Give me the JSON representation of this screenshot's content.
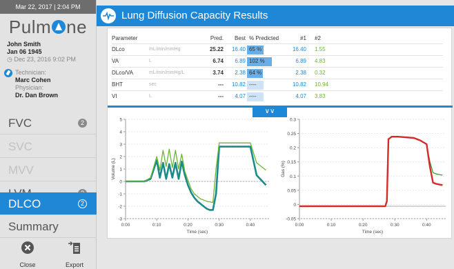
{
  "sidebar": {
    "datetime": "Mar 22, 2017 | 2:04 PM",
    "logo_left": "Pulm",
    "logo_right": "ne",
    "patient_name": "John  Smith",
    "patient_dob": "Jan 06 1945",
    "session_datetime": "Dec 23, 2016 9:02 PM",
    "technician_label": "Technician:",
    "technician_name": "Marc Cohen",
    "physician_label": "Physician:",
    "physician_name": "Dr. Dan Brown",
    "menu": [
      {
        "label": "FVC",
        "badge": "2"
      },
      {
        "label": "SVC",
        "badge": ""
      },
      {
        "label": "MVV",
        "badge": ""
      },
      {
        "label": "LVM",
        "badge": "2"
      },
      {
        "label": "DLCO",
        "badge": "2"
      },
      {
        "label": "Summary",
        "badge": ""
      }
    ],
    "close_label": "Close",
    "export_label": "Export"
  },
  "header": {
    "title": "Lung Diffusion Capacity Results"
  },
  "table": {
    "headers": [
      "Parameter",
      "",
      "Pred.",
      "Best",
      "% Predicted",
      "#1",
      "#2"
    ],
    "rows": [
      {
        "param": "DLco",
        "unit": "mL/min/mmHg",
        "pred": "25.22",
        "best": "16.40",
        "pct": "65 %",
        "t1": "16.40",
        "t2": "1.55"
      },
      {
        "param": "VA",
        "unit": "L",
        "pred": "6.74",
        "best": "6.89",
        "pct": "102 %",
        "t1": "6.89",
        "t2": "4.83"
      },
      {
        "param": "DLco/VA",
        "unit": "mL/min/mmHg/L",
        "pred": "3.74",
        "best": "2.38",
        "pct": "64 %",
        "t1": "2.38",
        "t2": "0.32"
      },
      {
        "param": "BHT",
        "unit": "sec",
        "pred": "---",
        "best": "10.82",
        "pct": "----",
        "t1": "10.82",
        "t2": "10.94"
      },
      {
        "param": "VI",
        "unit": "L",
        "pred": "---",
        "best": "4.07",
        "pct": "----",
        "t1": "4.07",
        "t2": "3.83"
      }
    ]
  },
  "colors": {
    "accent": "#1e88d6",
    "trial1": "#1a8a8a",
    "trial2": "#6ab534",
    "gas_red": "#d42a2a",
    "gas_green": "#3a9a3a"
  },
  "chart_data": [
    {
      "type": "line",
      "title": "",
      "xlabel": "Time (sec)",
      "ylabel": "Volume (L)",
      "xlim": [
        0,
        46
      ],
      "ylim": [
        -3,
        5
      ],
      "xticks": [
        "0:00",
        "0:10",
        "0:20",
        "0:30",
        "0:40"
      ],
      "yticks": [
        "5",
        "4",
        "3",
        "2",
        "1",
        "0",
        "-1",
        "-2",
        "-3"
      ],
      "series": [
        {
          "x": [
            0,
            6,
            8,
            10,
            11,
            12,
            13,
            14,
            15,
            16,
            17,
            18,
            19,
            20,
            21,
            22,
            23,
            24,
            25,
            26,
            27,
            28,
            29,
            30,
            31,
            40,
            42,
            45
          ],
          "y": [
            0,
            0,
            0.2,
            1.7,
            0.3,
            1.5,
            0.2,
            1.4,
            0.3,
            1.5,
            0.2,
            1.6,
            0.5,
            -0.3,
            -0.9,
            -1.3,
            -1.6,
            -1.8,
            -2.0,
            -2.2,
            -2.3,
            -2.3,
            -1.0,
            2.8,
            2.8,
            2.8,
            0.5,
            -0.3
          ]
        },
        {
          "x": [
            0,
            6,
            8,
            10,
            11,
            12,
            13,
            14,
            15,
            16,
            17,
            18,
            19,
            20,
            21,
            22,
            24,
            26,
            28,
            29,
            30,
            31,
            40,
            42,
            45
          ],
          "y": [
            0,
            0,
            0.3,
            2.0,
            0.9,
            2.5,
            1.2,
            2.6,
            1.1,
            2.5,
            1.0,
            2.2,
            0.8,
            0.1,
            -0.6,
            -1.0,
            -1.4,
            -1.6,
            -1.7,
            1.0,
            3.1,
            3.1,
            3.1,
            1.5,
            0.9
          ]
        }
      ]
    },
    {
      "type": "line",
      "title": "",
      "xlabel": "Time (sec)",
      "ylabel": "Gas (%)",
      "xlim": [
        0,
        46
      ],
      "ylim": [
        -0.05,
        0.35
      ],
      "xticks": [
        "0:00",
        "0:10",
        "0:20",
        "0:30",
        "0:40"
      ],
      "yticks": [
        "0.3",
        "0.25",
        "0.2",
        "0.15",
        "0.1",
        "0.05",
        "0",
        "-0.05"
      ],
      "series": [
        {
          "x": [
            0,
            27,
            27.5,
            28,
            29,
            31,
            36,
            38,
            40,
            41,
            42,
            43,
            45
          ],
          "y": [
            0,
            0,
            0.02,
            0.27,
            0.28,
            0.28,
            0.275,
            0.265,
            0.25,
            0.18,
            0.135,
            0.13,
            0.125
          ]
        },
        {
          "x": [
            0,
            27,
            27.5,
            28,
            29,
            31,
            36,
            38,
            40,
            41,
            42,
            43,
            45
          ],
          "y": [
            0,
            0,
            0.02,
            0.27,
            0.28,
            0.28,
            0.275,
            0.265,
            0.25,
            0.16,
            0.095,
            0.09,
            0.085
          ]
        }
      ]
    }
  ]
}
